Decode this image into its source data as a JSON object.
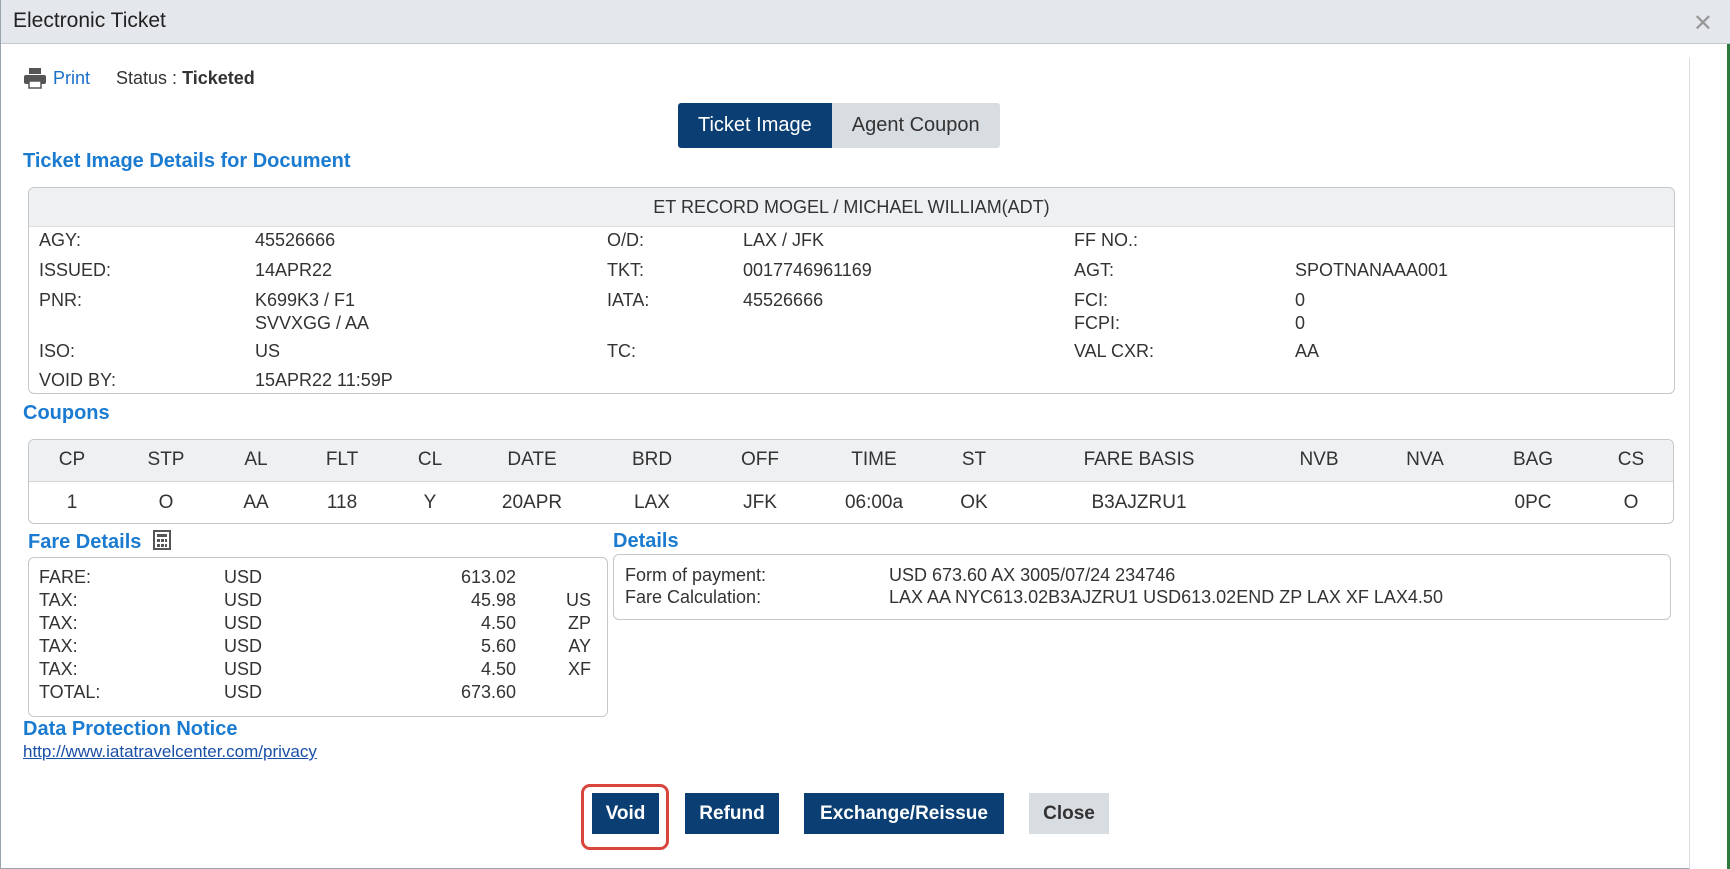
{
  "window": {
    "title": "Electronic Ticket"
  },
  "toolbar": {
    "print_label": "Print",
    "status_label": "Status : ",
    "status_value": "Ticketed"
  },
  "view_toggle": {
    "options": [
      "Ticket Image",
      "Agent Coupon"
    ],
    "selected": "Ticket Image"
  },
  "ticket_section": {
    "heading": "Ticket Image Details for Document"
  },
  "et_record": {
    "header": "ET RECORD    MOGEL / MICHAEL WILLIAM(ADT)",
    "fields": {
      "agy_label": "AGY:",
      "agy_value": "45526666",
      "issued_label": "ISSUED:",
      "issued_value": "14APR22",
      "pnr_label": "PNR:",
      "pnr_value_1": "K699K3 / F1",
      "pnr_value_2": "SVVXGG / AA",
      "iso_label": "ISO:",
      "iso_value": "US",
      "void_by_label": "VOID BY:",
      "void_by_value": "15APR22 11:59P",
      "od_label": "O/D:",
      "od_value": "LAX / JFK",
      "tkt_label": "TKT:",
      "tkt_value": "0017746961169",
      "iata_label": "IATA:",
      "iata_value": "45526666",
      "tc_label": "TC:",
      "ffno_label": "FF NO.:",
      "agt_label": "AGT:",
      "agt_value": "SPOTNANAAA001",
      "fci_label": "FCI:",
      "fci_value": "0",
      "fcpi_label": "FCPI:",
      "fcpi_value": "0",
      "valcxr_label": "VAL CXR:",
      "valcxr_value": "AA"
    }
  },
  "coupons": {
    "heading": "Coupons",
    "columns": [
      "CP",
      "STP",
      "AL",
      "FLT",
      "CL",
      "DATE",
      "BRD",
      "OFF",
      "TIME",
      "ST",
      "FARE BASIS",
      "NVB",
      "NVA",
      "BAG",
      "CS"
    ],
    "rows": [
      [
        "1",
        "O",
        "AA",
        "118",
        "Y",
        "20APR",
        "LAX",
        "JFK",
        "06:00a",
        "OK",
        "B3AJZRU1",
        "",
        "",
        "0PC",
        "O"
      ]
    ]
  },
  "fare_details": {
    "heading": "Fare Details",
    "icon": "calculator-icon",
    "rows": [
      {
        "label": "FARE:",
        "currency": "USD",
        "amount": "613.02",
        "code": ""
      },
      {
        "label": "TAX:",
        "currency": "USD",
        "amount": "45.98",
        "code": "US"
      },
      {
        "label": "TAX:",
        "currency": "USD",
        "amount": "4.50",
        "code": "ZP"
      },
      {
        "label": "TAX:",
        "currency": "USD",
        "amount": "5.60",
        "code": "AY"
      },
      {
        "label": "TAX:",
        "currency": "USD",
        "amount": "4.50",
        "code": "XF"
      },
      {
        "label": "TOTAL:",
        "currency": "USD",
        "amount": "673.60",
        "code": ""
      }
    ]
  },
  "details": {
    "heading": "Details",
    "form_of_payment_label": "Form of payment:",
    "form_of_payment_value": "USD 673.60 AX 3005/07/24 234746",
    "fare_calc_label": "Fare Calculation:",
    "fare_calc_value": "LAX AA NYC613.02B3AJZRU1 USD613.02END ZP LAX XF LAX4.50"
  },
  "data_protection": {
    "heading": "Data Protection Notice",
    "link": "http://www.iatatravelcenter.com/privacy"
  },
  "actions": {
    "void": "Void",
    "refund": "Refund",
    "exchange": "Exchange/Reissue",
    "close": "Close"
  },
  "colors": {
    "primary": "#0b3f74",
    "accent": "#1a7bd0",
    "highlight": "#d9443c"
  }
}
